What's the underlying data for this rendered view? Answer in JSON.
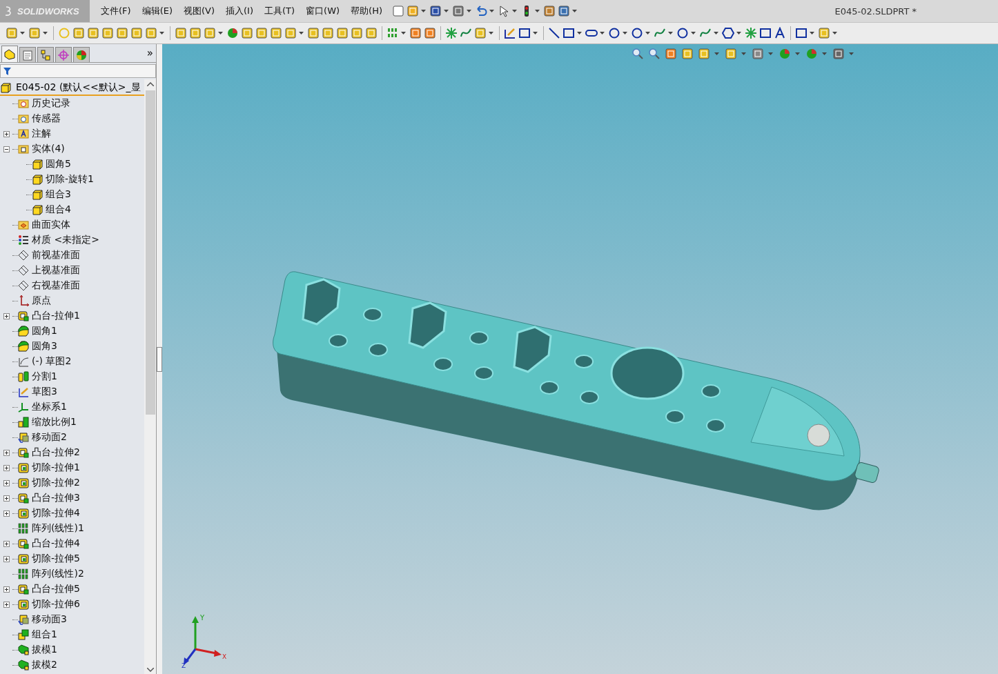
{
  "title_bar": {
    "logo": "SOLIDWORKS",
    "menus": [
      "文件(F)",
      "编辑(E)",
      "视图(V)",
      "插入(I)",
      "工具(T)",
      "窗口(W)",
      "帮助(H)"
    ],
    "document_title": "E045-02.SLDPRT *"
  },
  "panel_tabs": [
    {
      "selected": true
    },
    {
      "selected": false
    },
    {
      "selected": false
    },
    {
      "selected": false
    },
    {
      "selected": false
    }
  ],
  "panel_more": "»",
  "tree": {
    "root": "E045-02  (默认<<默认>_显",
    "items": [
      {
        "label": "历史记录",
        "kind": "history"
      },
      {
        "label": "传感器",
        "kind": "sensor"
      },
      {
        "label": "注解",
        "kind": "annotation",
        "expanded": false
      },
      {
        "label": "实体(4)",
        "kind": "bodies",
        "expanded": true,
        "children": [
          {
            "label": "圆角5",
            "kind": "body"
          },
          {
            "label": "切除-旋转1",
            "kind": "body"
          },
          {
            "label": "组合3",
            "kind": "body"
          },
          {
            "label": "组合4",
            "kind": "body"
          }
        ]
      },
      {
        "label": "曲面实体",
        "kind": "surfaces"
      },
      {
        "label": "材质 <未指定>",
        "kind": "material"
      },
      {
        "label": "前视基准面",
        "kind": "plane"
      },
      {
        "label": "上视基准面",
        "kind": "plane"
      },
      {
        "label": "右视基准面",
        "kind": "plane"
      },
      {
        "label": "原点",
        "kind": "origin"
      },
      {
        "label": "凸台-拉伸1",
        "kind": "boss",
        "expanded": false
      },
      {
        "label": "圆角1",
        "kind": "fillet"
      },
      {
        "label": "圆角3",
        "kind": "fillet"
      },
      {
        "label": "(-) 草图2",
        "kind": "sketch"
      },
      {
        "label": "分割1",
        "kind": "split"
      },
      {
        "label": "草图3",
        "kind": "sketch_active"
      },
      {
        "label": "坐标系1",
        "kind": "coordinate"
      },
      {
        "label": "缩放比例1",
        "kind": "scale"
      },
      {
        "label": "移动面2",
        "kind": "move_face"
      },
      {
        "label": "凸台-拉伸2",
        "kind": "boss",
        "expanded": false
      },
      {
        "label": "切除-拉伸1",
        "kind": "cut",
        "expanded": false
      },
      {
        "label": "切除-拉伸2",
        "kind": "cut",
        "expanded": false
      },
      {
        "label": "凸台-拉伸3",
        "kind": "boss",
        "expanded": false
      },
      {
        "label": "切除-拉伸4",
        "kind": "cut",
        "expanded": false
      },
      {
        "label": "阵列(线性)1",
        "kind": "pattern"
      },
      {
        "label": "凸台-拉伸4",
        "kind": "boss",
        "expanded": false
      },
      {
        "label": "切除-拉伸5",
        "kind": "cut",
        "expanded": false
      },
      {
        "label": "阵列(线性)2",
        "kind": "pattern"
      },
      {
        "label": "凸台-拉伸5",
        "kind": "boss",
        "expanded": false
      },
      {
        "label": "切除-拉伸6",
        "kind": "cut",
        "expanded": false
      },
      {
        "label": "移动面3",
        "kind": "move_face"
      },
      {
        "label": "组合1",
        "kind": "combine"
      },
      {
        "label": "拔模1",
        "kind": "draft"
      },
      {
        "label": "拔模2",
        "kind": "draft"
      }
    ]
  },
  "triad": {
    "x": "X",
    "y": "Y",
    "z": "Z"
  }
}
